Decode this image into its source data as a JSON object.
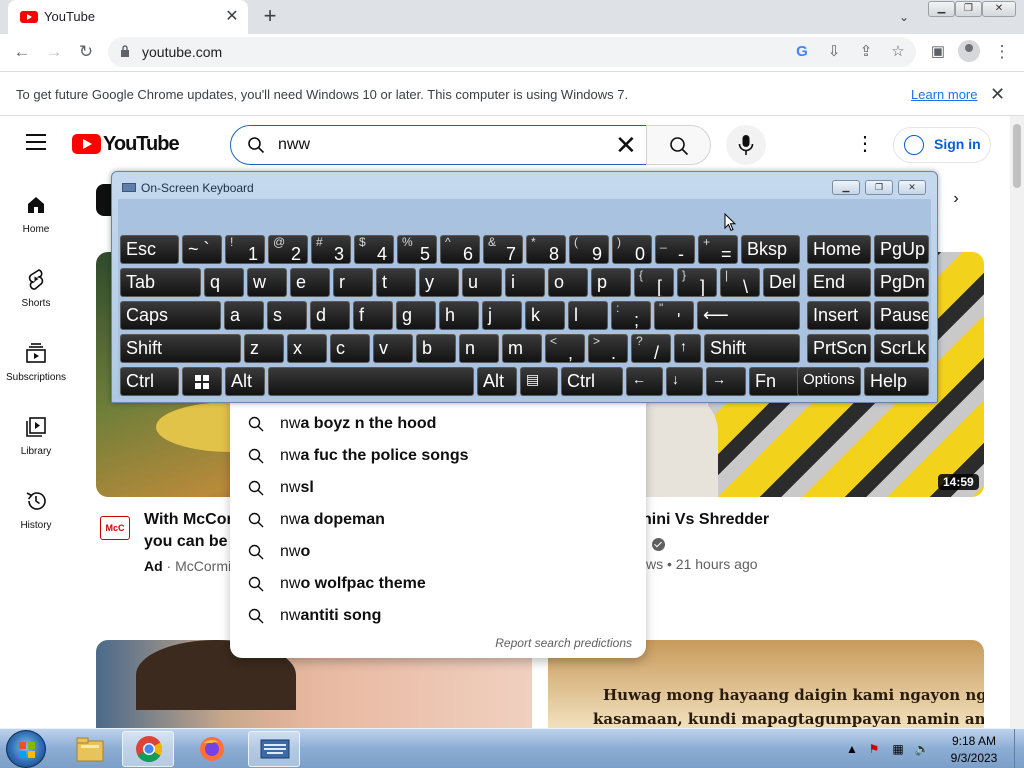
{
  "browser": {
    "tab_title": "YouTube",
    "url": "youtube.com",
    "infobar_text": "To get future Google Chrome updates, you'll need Windows 10 or later. This computer is using Windows 7.",
    "infobar_link": "Learn more"
  },
  "youtube": {
    "logo_text": "YouTube",
    "search_query": "nww",
    "sign_in_label": "Sign in",
    "sidebar": [
      {
        "label": "Home",
        "icon": "home-icon"
      },
      {
        "label": "Shorts",
        "icon": "shorts-icon"
      },
      {
        "label": "Subscriptions",
        "icon": "subscriptions-icon"
      },
      {
        "label": "Library",
        "icon": "library-icon"
      },
      {
        "label": "History",
        "icon": "history-icon"
      }
    ],
    "suggestions": [
      {
        "typed": "nw",
        "rest": "a boyz n the hood"
      },
      {
        "typed": "nw",
        "rest": "a fuc the police songs"
      },
      {
        "typed": "nw",
        "rest": "sl"
      },
      {
        "typed": "nw",
        "rest": "a dopeman"
      },
      {
        "typed": "nw",
        "rest": "o"
      },
      {
        "typed": "nw",
        "rest": "o wolfpac theme"
      },
      {
        "typed": "nw",
        "rest": "antiti song"
      }
    ],
    "report_predictions": "Report search predictions",
    "video_1": {
      "title_line_1": "With McCor",
      "title_line_2": "you can be s",
      "ad_badge": "Ad",
      "channel": "McCormi",
      "logo_text": "McC"
    },
    "video_2": {
      "title": "rghini Vs Shredder",
      "meta": "ws • 21 hours ago",
      "duration": "14:59"
    },
    "video_4": {
      "verse_line_1": "Huwag mong hayaang daigin kami ngayon ng",
      "verse_line_2": "kasamaan, kundi mapagtagumpayan namin ang"
    }
  },
  "osk": {
    "title": "On-Screen Keyboard",
    "keys": {
      "esc": "Esc",
      "bksp": "Bksp",
      "home": "Home",
      "pgup": "PgUp",
      "tab": "Tab",
      "del": "Del",
      "end": "End",
      "pgdn": "PgDn",
      "caps": "Caps",
      "insert": "Insert",
      "pause": "Pause",
      "shift": "Shift",
      "prtscn": "PrtScn",
      "scrlk": "ScrLk",
      "ctrl": "Ctrl",
      "alt": "Alt",
      "fn": "Fn",
      "options": "Options",
      "help": "Help"
    }
  },
  "taskbar": {
    "time": "9:18 AM",
    "date": "9/3/2023"
  }
}
